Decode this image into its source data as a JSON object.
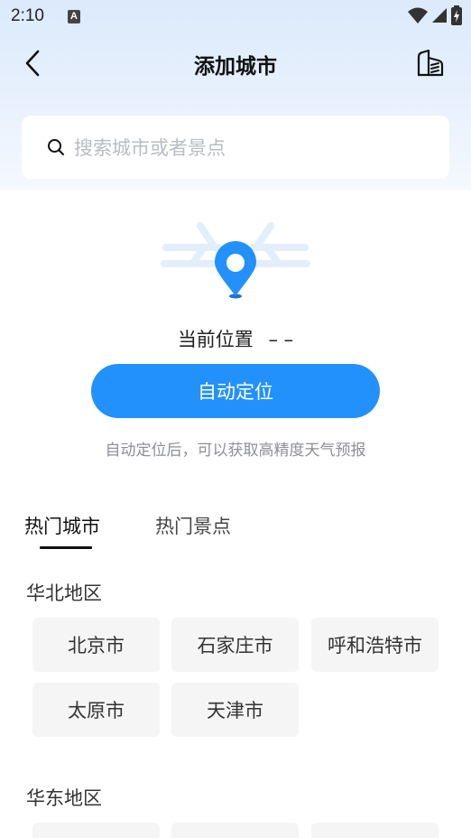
{
  "status_bar": {
    "time": "2:10",
    "notif_badge": "A"
  },
  "nav": {
    "title": "添加城市"
  },
  "search": {
    "placeholder": "搜索城市或者景点"
  },
  "location": {
    "current_label": "当前位置",
    "current_value": "– –",
    "auto_button": "自动定位",
    "hint": "自动定位后，可以获取高精度天气预报"
  },
  "tabs": [
    {
      "label": "热门城市",
      "active": true
    },
    {
      "label": "热门景点",
      "active": false
    }
  ],
  "regions": [
    {
      "name": "华北地区",
      "cities": [
        "北京市",
        "石家庄市",
        "呼和浩特市",
        "太原市",
        "天津市"
      ]
    },
    {
      "name": "华东地区",
      "cities": [
        "",
        "",
        ""
      ]
    }
  ],
  "colors": {
    "accent": "#2391fb",
    "chip_bg": "#f5f5f5",
    "header_gradient_top": "#dceafc"
  }
}
